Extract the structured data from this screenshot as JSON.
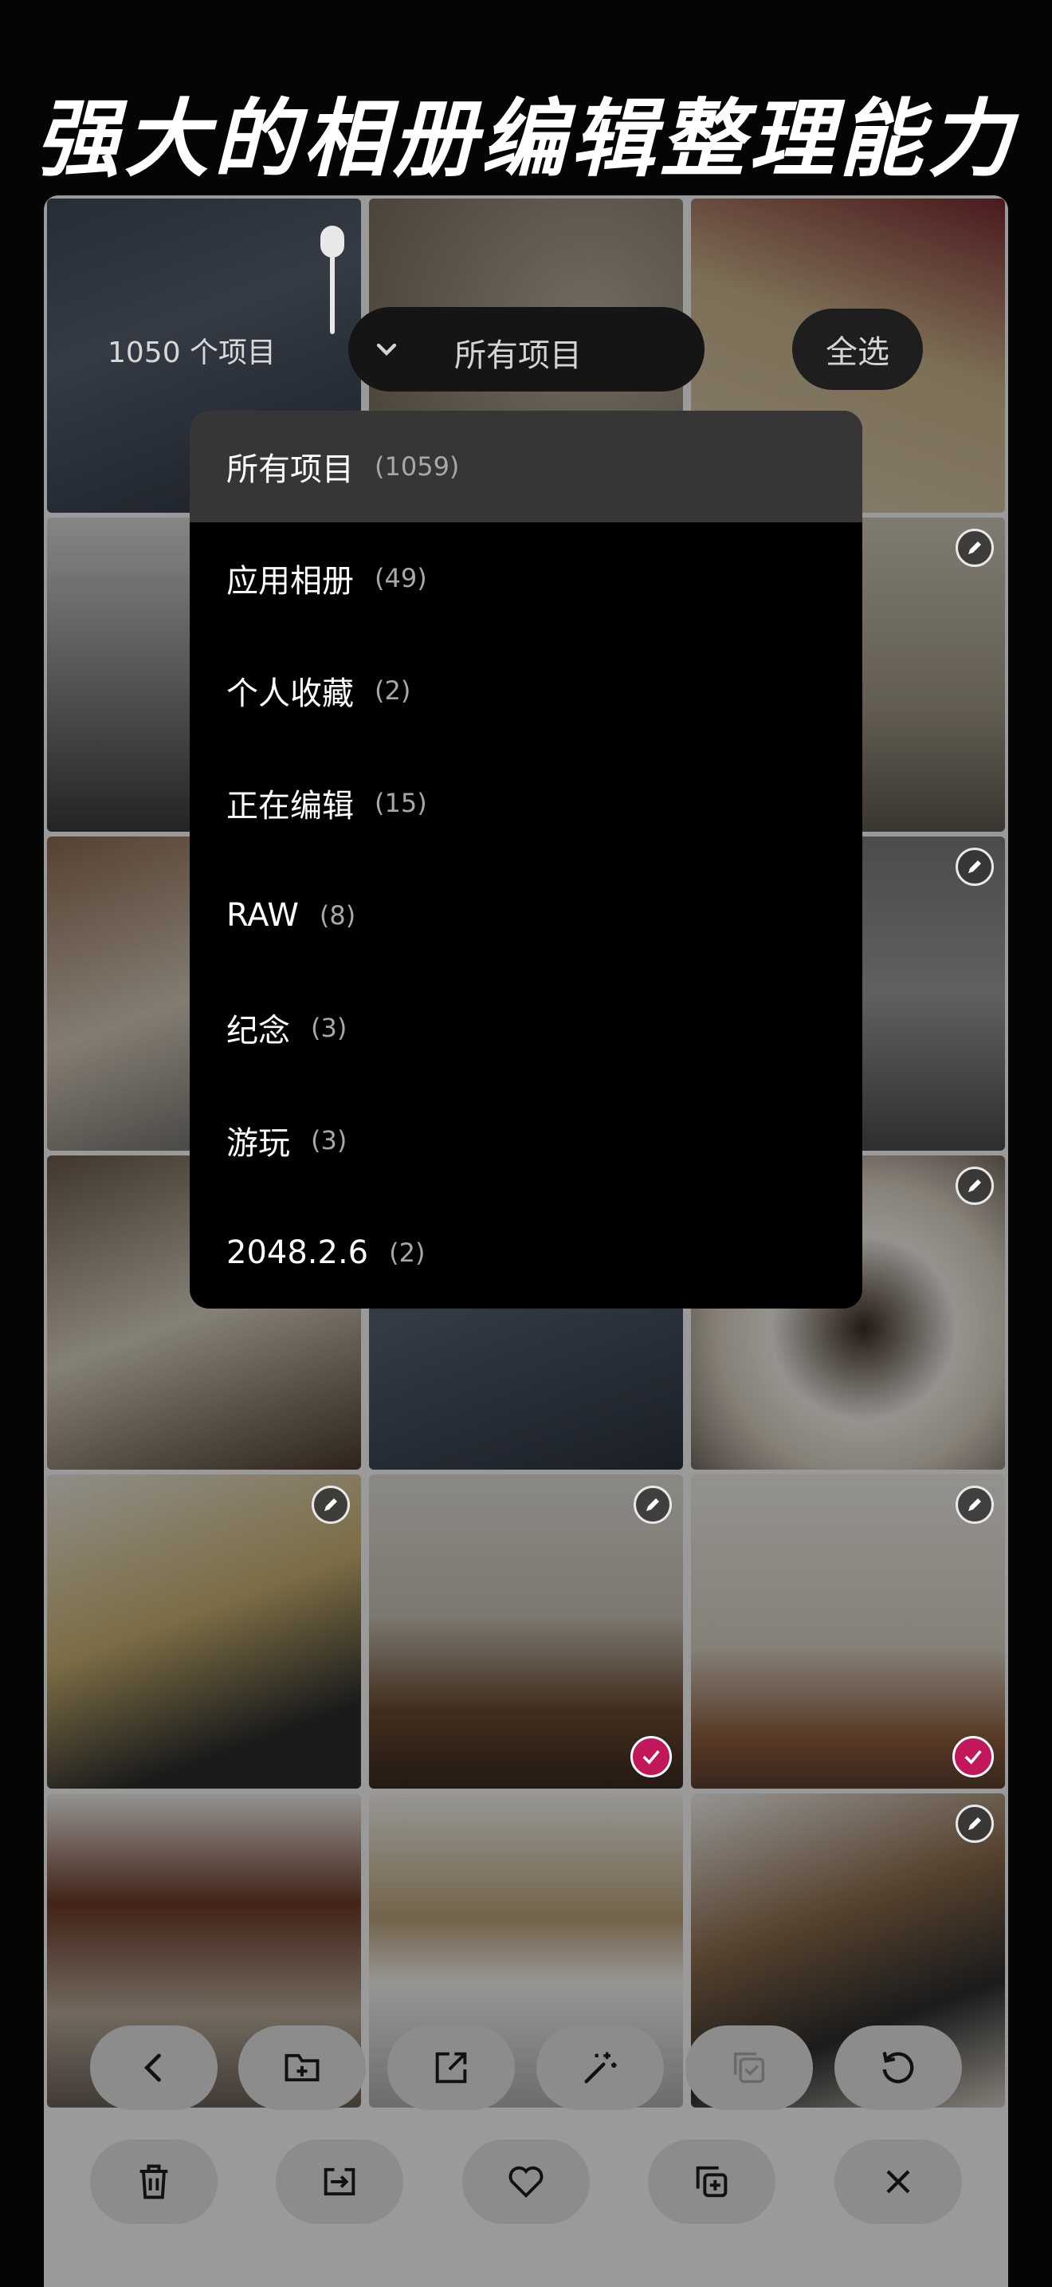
{
  "headline": "强大的相册编辑整理能力",
  "top_bar": {
    "count_label": "1050 个项目",
    "album_selector": "所有项目",
    "select_all": "全选"
  },
  "dropdown": {
    "items": [
      {
        "label": "所有项目",
        "count": "(1059)",
        "active": true
      },
      {
        "label": "应用相册",
        "count": "(49)"
      },
      {
        "label": "个人收藏",
        "count": "(2)"
      },
      {
        "label": "正在编辑",
        "count": "(15)"
      },
      {
        "label": "RAW",
        "count": "(8)"
      },
      {
        "label": "纪念",
        "count": "(3)"
      },
      {
        "label": "游玩",
        "count": "(3)"
      },
      {
        "label": "2048.2.6",
        "count": "(2)"
      }
    ]
  },
  "tile_badges": {
    "edit_icon": "pencil-icon",
    "selected_icon": "check-icon",
    "selected_color": "#c2185b"
  },
  "toolbar": {
    "row1": [
      "back-icon",
      "add-to-folder-icon",
      "share-icon",
      "magic-wand-icon",
      "copy-check-icon",
      "rotate-icon"
    ],
    "row2": [
      "trash-icon",
      "move-icon",
      "heart-icon",
      "duplicate-icon",
      "close-icon"
    ]
  }
}
